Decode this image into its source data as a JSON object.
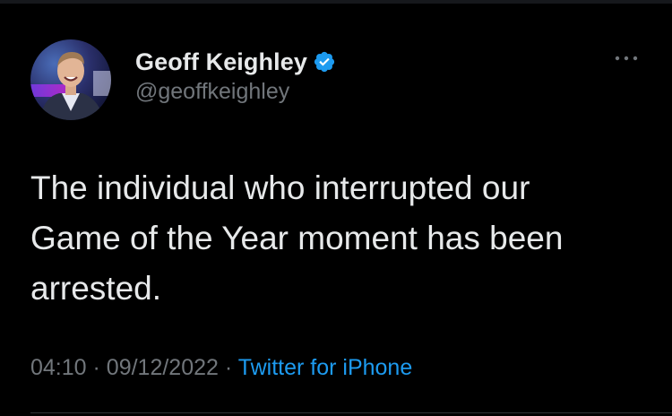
{
  "tweet": {
    "author": {
      "display_name": "Geoff Keighley",
      "handle": "@geoffkeighley",
      "avatar_icon": "profile-photo",
      "verified": true,
      "verified_color": "#1d9bf0"
    },
    "text": "The individual who interrupted our\nGame of the Year moment has been\narrested.",
    "meta": {
      "time": "04:10",
      "separator": "·",
      "date": "09/12/2022",
      "source": "Twitter for iPhone"
    },
    "more_icon": "ellipsis-icon"
  },
  "colors": {
    "background": "#000000",
    "text": "#e7e9ea",
    "secondary": "#71767b",
    "accent": "#1d9bf0"
  }
}
